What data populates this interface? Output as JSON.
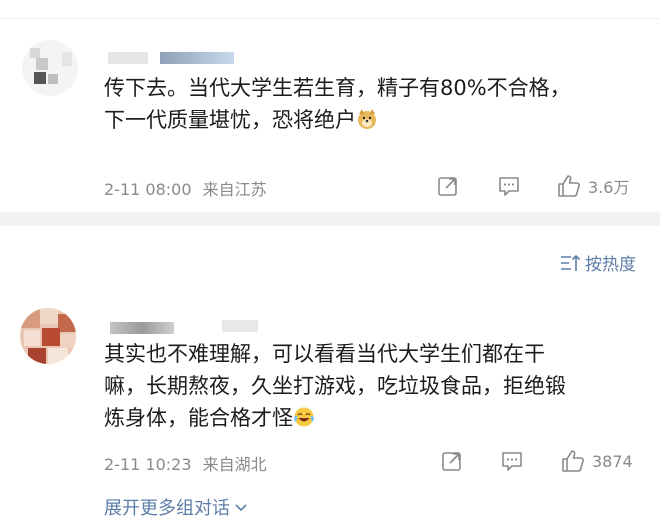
{
  "comments": [
    {
      "text_line1": "传下去。当代大学生若生育，精子有80%不合格，",
      "text_line2": "下一代质量堪忧，恐将绝户",
      "emoji": "doge-emoji",
      "time": "2-11 08:00",
      "location": "来自江苏",
      "likes": "3.6万"
    },
    {
      "text_line1": "其实也不难理解，可以看看当代大学生们都在干",
      "text_line2": "嘛，长期熬夜，久坐打游戏，吃垃圾食品，拒绝锻",
      "text_line3": "炼身体，能合格才怪",
      "emoji": "laugh-cry-emoji",
      "time": "2-11 10:23",
      "location": "来自湖北",
      "likes": "3874"
    }
  ],
  "sort_label": "按热度",
  "expand_label": "展开更多组对话",
  "icons": {
    "share": "share-icon",
    "comment": "comment-icon",
    "like": "like-icon",
    "sort": "sort-icon",
    "chevron": "chevron-down-icon"
  },
  "colors": {
    "link_blue": "#5d7da8",
    "meta_gray": "#8a8a8a",
    "divider_gray": "#f2f2f2"
  }
}
